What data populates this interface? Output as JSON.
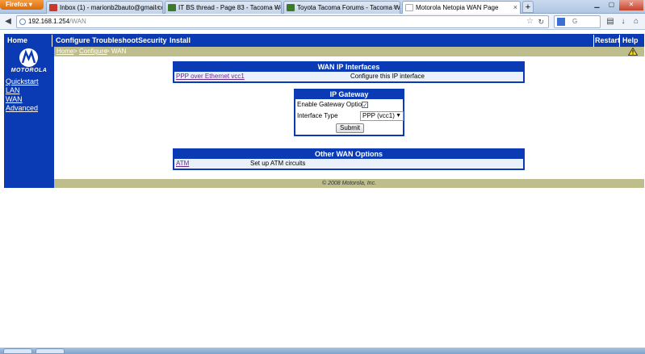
{
  "browser": {
    "app_button": "Firefox",
    "tabs": [
      {
        "title": "Inbox (1) - marionb2bauto@gmail.co...",
        "favicon_color": "#c9382a",
        "active": false
      },
      {
        "title": "IT BS thread - Page 83 - Tacoma Worl...",
        "favicon_color": "#3b7a2c",
        "active": false
      },
      {
        "title": "Toyota Tacoma Forums - Tacoma W...",
        "favicon_color": "#3b7a2c",
        "active": false
      },
      {
        "title": "Motorola Netopia WAN Page",
        "favicon_color": "#ffffff",
        "active": true
      }
    ],
    "new_tab_label": "+",
    "url_host": "192.168.1.254",
    "url_path": "/WAN",
    "search_placeholder": "G"
  },
  "router": {
    "top_nav": {
      "home": "Home",
      "configure": "Configure",
      "troubleshoot": "Troubleshoot",
      "security": "Security",
      "install": "Install",
      "restart": "Restart",
      "help": "Help"
    },
    "brand": "MOTOROLA",
    "side_nav": [
      "Quickstart",
      "LAN",
      "WAN",
      "Advanced"
    ],
    "breadcrumb": {
      "home": "Home",
      "configure": "Configure",
      "current": "WAN"
    },
    "wan_ip_interfaces": {
      "title": "WAN IP Interfaces",
      "rows": [
        {
          "name": "PPP over Ethernet vcc1",
          "description": "Configure this IP interface"
        }
      ]
    },
    "ip_gateway": {
      "title": "IP Gateway",
      "enable_label": "Enable Gateway Option",
      "enable_checked": true,
      "interface_label": "Interface Type",
      "interface_value": "PPP (vcc1)",
      "submit_label": "Submit"
    },
    "other_wan_options": {
      "title": "Other WAN Options",
      "rows": [
        {
          "name": "ATM",
          "description": "Set up ATM circuits"
        }
      ]
    },
    "footer": "© 2008 Motorola, Inc."
  },
  "colors": {
    "nav_blue": "#0a3bb5",
    "breadcrumb_olive": "#bebd8c",
    "row_bg": "#eaf1fa",
    "visited_link": "#6b2a8a"
  }
}
